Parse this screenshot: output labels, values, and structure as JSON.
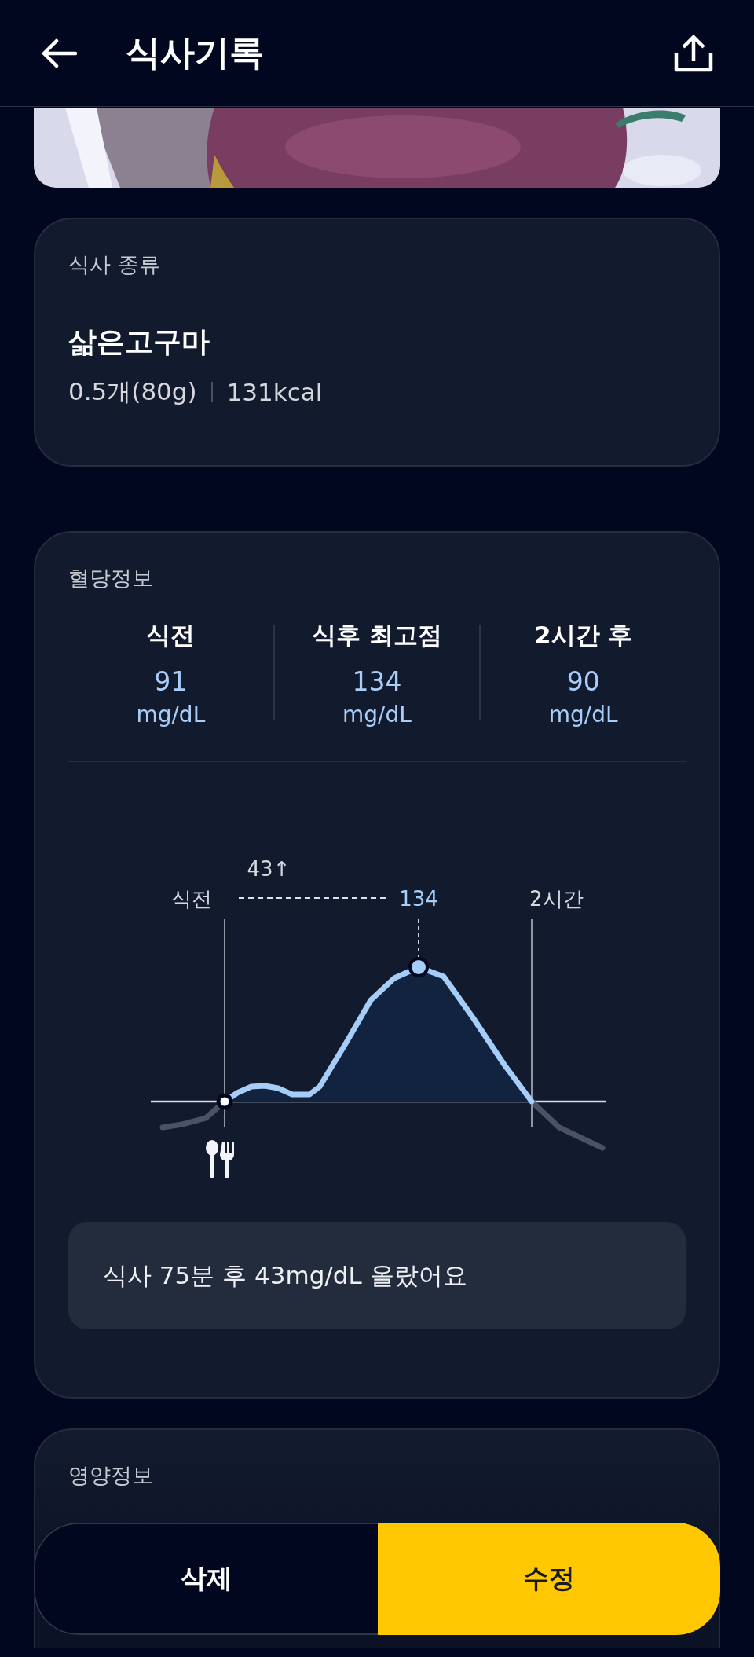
{
  "header": {
    "title": "식사기록"
  },
  "meal_type": {
    "label": "식사 종류",
    "food": "삶은고구마",
    "amount": "0.5개(80g)",
    "calories": "131kcal"
  },
  "blood_sugar": {
    "title": "혈당정보",
    "stats": [
      {
        "label": "식전",
        "value": "91",
        "unit": "mg/dL"
      },
      {
        "label": "식후 최고점",
        "value": "134",
        "unit": "mg/dL"
      },
      {
        "label": "2시간 후",
        "value": "90",
        "unit": "mg/dL"
      }
    ],
    "chart": {
      "start_label": "식전",
      "rise_label": "43↑",
      "peak_label": "134",
      "end_label": "2시간"
    },
    "summary": "식사 75분 후 43mg/dL 올랐어요"
  },
  "nutrition": {
    "title": "영양정보"
  },
  "buttons": [
    {
      "label": "삭제",
      "kind": "secondary"
    },
    {
      "label": "수정",
      "kind": "primary"
    }
  ]
}
